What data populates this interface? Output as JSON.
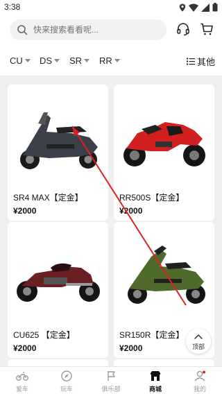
{
  "status_bar": {
    "time": "3:38"
  },
  "search": {
    "placeholder": "快来搜索看看呢..."
  },
  "filters": [
    {
      "label": "CU"
    },
    {
      "label": "DS"
    },
    {
      "label": "SR"
    },
    {
      "label": "RR"
    }
  ],
  "more_filter_label": "其他",
  "products": [
    {
      "title": "SR4 MAX【定金】",
      "price": "¥2000",
      "color": "#3a3f4a"
    },
    {
      "title": "RR500S【定金】",
      "price": "¥2000",
      "color": "#d21f1f"
    },
    {
      "title": "CU625 【定金】",
      "price": "¥2000",
      "color": "#6a1f22"
    },
    {
      "title": "SR150R【定金】",
      "price": "¥2000",
      "color": "#4f6b2c"
    }
  ],
  "back_to_top_label": "顶部",
  "tabs": [
    {
      "label": "爱车",
      "icon": "motorbike-icon"
    },
    {
      "label": "玩车",
      "icon": "compass-icon"
    },
    {
      "label": "俱乐部",
      "icon": "flag-icon"
    },
    {
      "label": "商城",
      "icon": "shop-icon",
      "active": true
    },
    {
      "label": "我的",
      "icon": "profile-icon"
    }
  ],
  "colors": {
    "accent_arrow": "#e02020",
    "active_tab": "#111111",
    "inactive_tab": "#999999"
  }
}
